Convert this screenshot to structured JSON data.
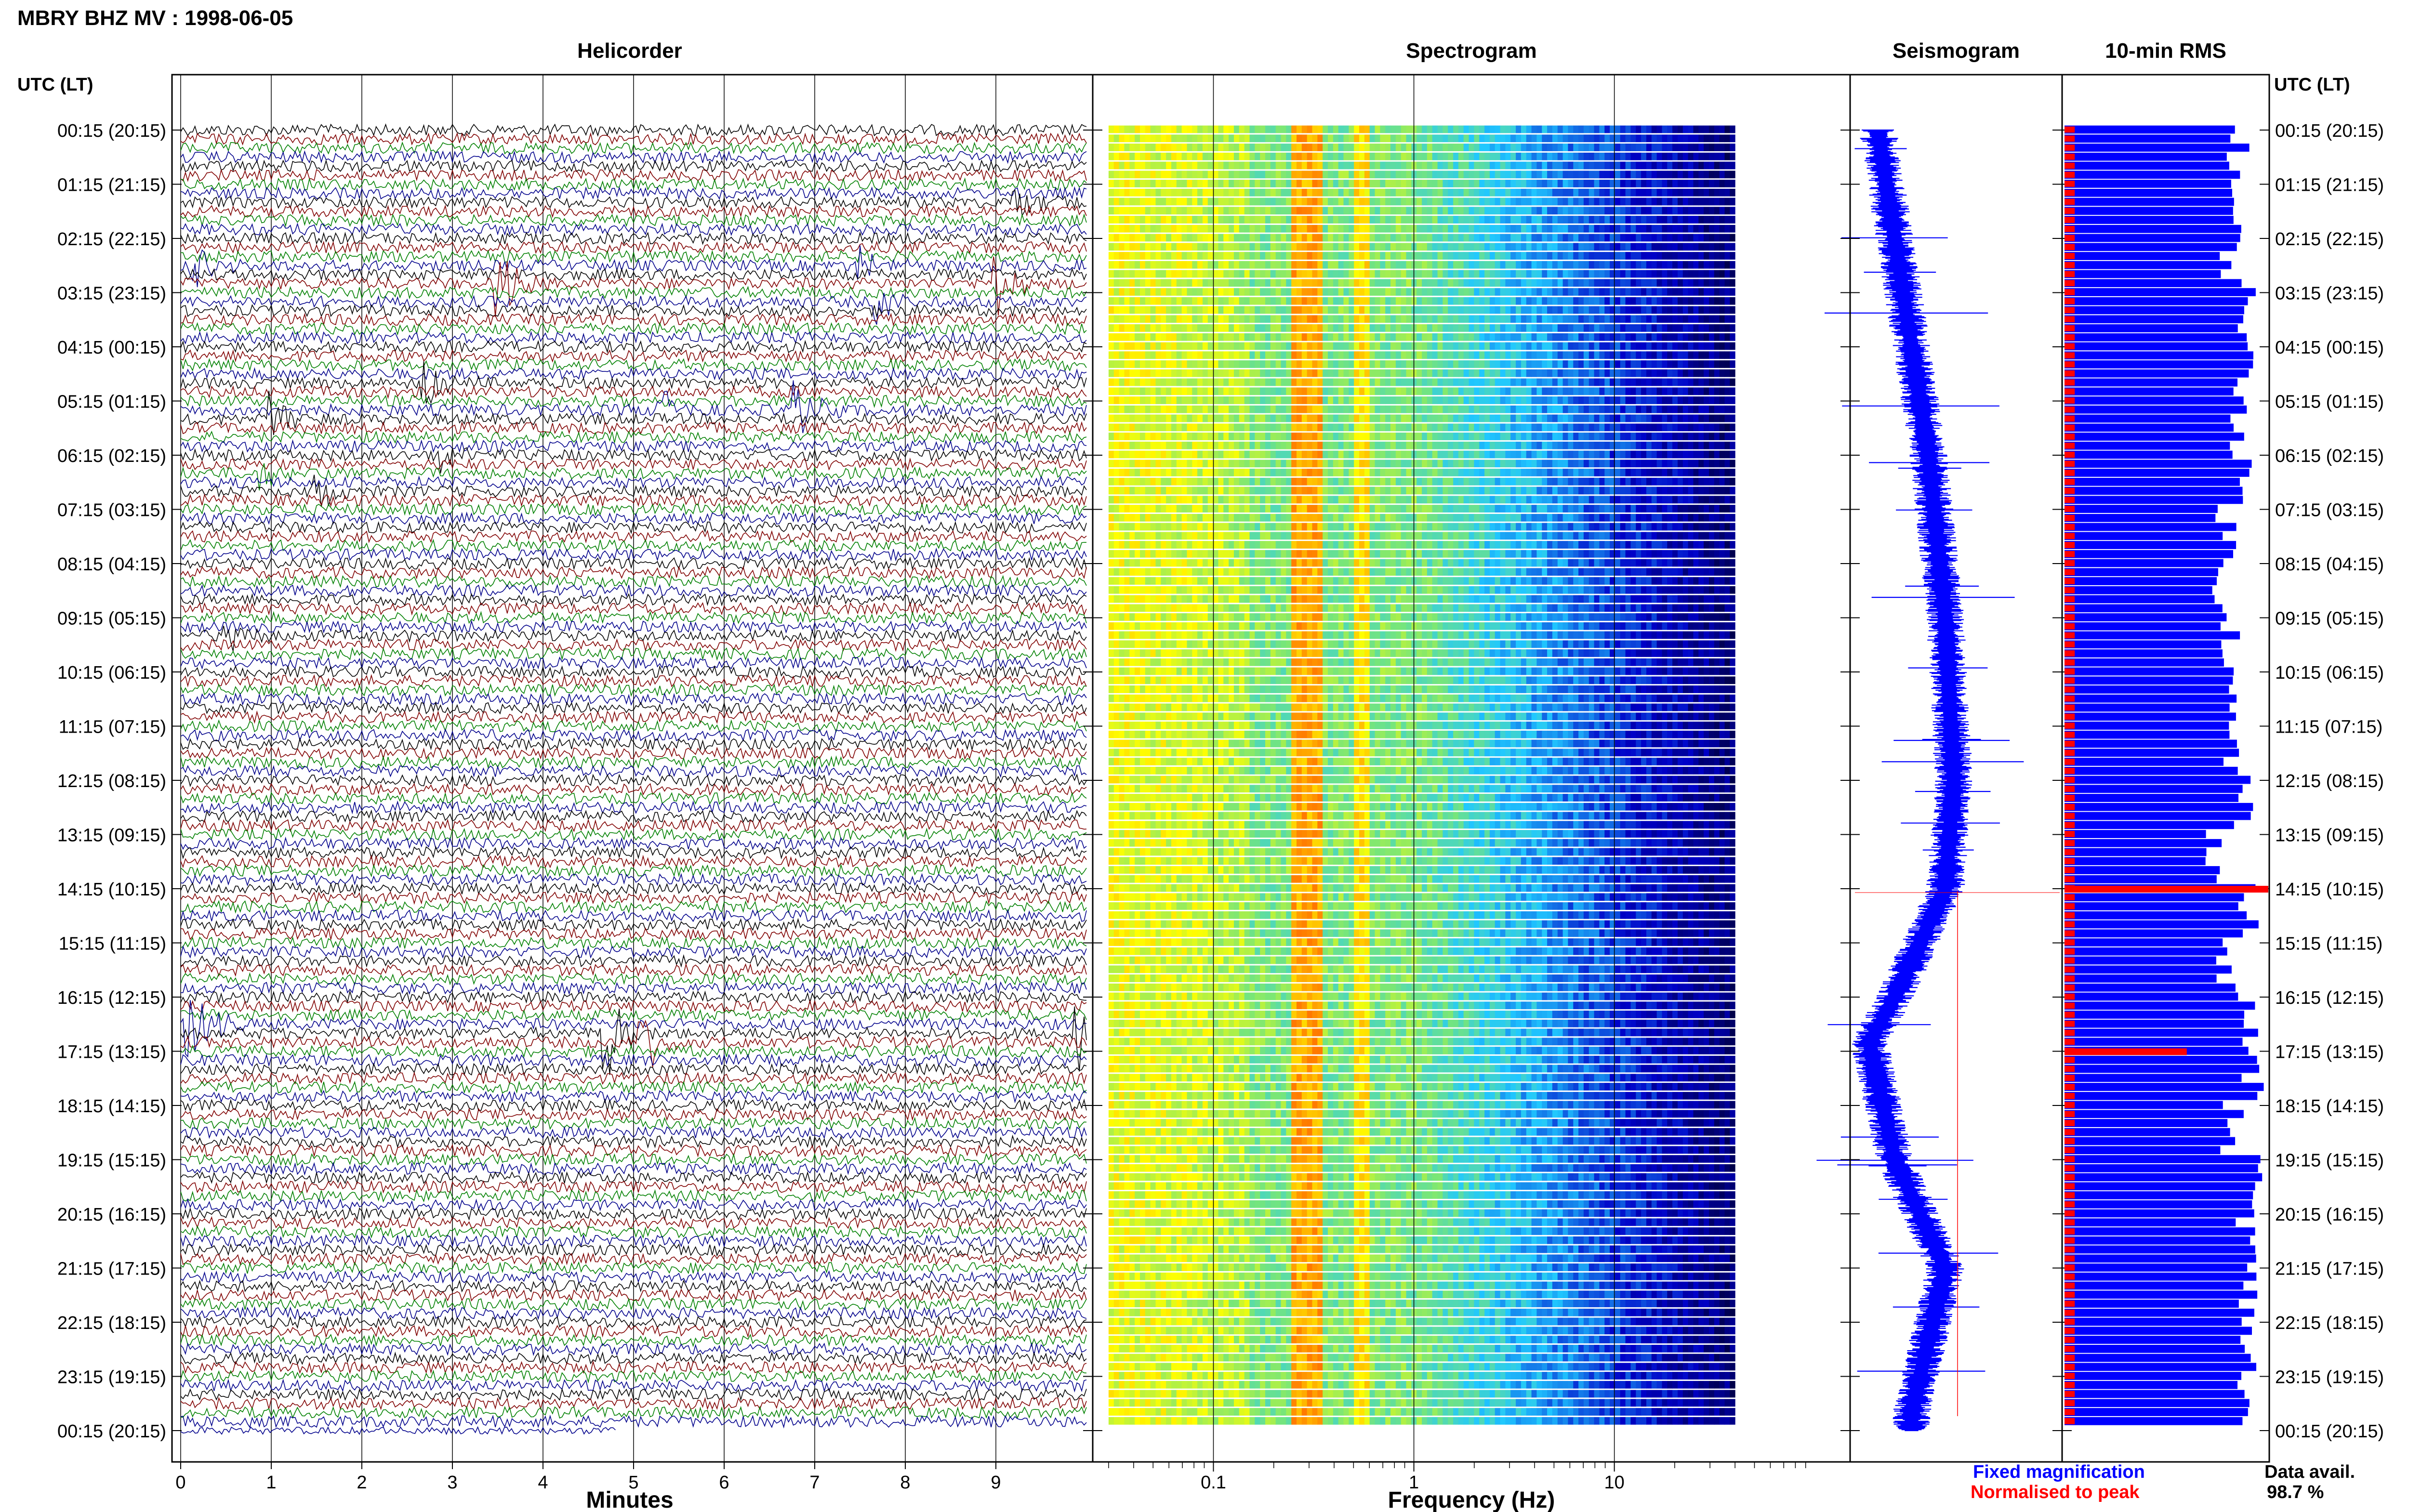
{
  "header": {
    "station_title": "MBRY BHZ MV : 1998-06-05",
    "time_axis_label": "UTC (LT)",
    "time_axis_label_right": "UTC (LT)"
  },
  "panels": {
    "helicorder": {
      "title": "Helicorder",
      "xlabel": "Minutes",
      "x_ticks": [
        "0",
        "1",
        "2",
        "3",
        "4",
        "5",
        "6",
        "7",
        "8",
        "9"
      ]
    },
    "spectrogram": {
      "title": "Spectrogram",
      "xlabel": "Frequency (Hz)",
      "x_ticks": [
        "0.1",
        "1",
        "10"
      ]
    },
    "seismogram": {
      "title": "Seismogram"
    },
    "rms": {
      "title": "10-min RMS"
    }
  },
  "time_labels": [
    "00:15 (20:15)",
    "01:15 (21:15)",
    "02:15 (22:15)",
    "03:15 (23:15)",
    "04:15 (00:15)",
    "05:15 (01:15)",
    "06:15 (02:15)",
    "07:15 (03:15)",
    "08:15 (04:15)",
    "09:15 (05:15)",
    "10:15 (06:15)",
    "11:15 (07:15)",
    "12:15 (08:15)",
    "13:15 (09:15)",
    "14:15 (10:15)",
    "15:15 (11:15)",
    "16:15 (12:15)",
    "17:15 (13:15)",
    "18:15 (14:15)",
    "19:15 (15:15)",
    "20:15 (16:15)",
    "21:15 (17:15)",
    "22:15 (18:15)",
    "23:15 (19:15)",
    "00:15 (20:15)"
  ],
  "legend": {
    "fixed": "Fixed magnification",
    "fixed_color": "#0000ff",
    "normalised": "Normalised to peak",
    "normalised_color": "#ff0000"
  },
  "availability": {
    "label": "Data avail.",
    "value": "98.7 %"
  },
  "colors": {
    "trace_cycle": [
      "#000000",
      "#800000",
      "#008000",
      "#00008b"
    ],
    "seismogram": "#0000ff",
    "rms_fixed": "#0000ff",
    "rms_normalised": "#ff0000"
  },
  "chart_data": [
    {
      "type": "line",
      "title": "Helicorder",
      "xlabel": "Minutes",
      "xlim": [
        0,
        10
      ],
      "rows_per_hour": 6,
      "rows": 144,
      "events": [
        {
          "time_utc": "01:35",
          "minute": 9.2,
          "amp": 1.0
        },
        {
          "time_utc": "02:45",
          "minute": 0.1,
          "amp": 1.3
        },
        {
          "time_utc": "02:45",
          "minute": 7.5,
          "amp": 1.2
        },
        {
          "time_utc": "03:05",
          "minute": 3.5,
          "amp": 1.8
        },
        {
          "time_utc": "03:05",
          "minute": 9.0,
          "amp": 1.7
        },
        {
          "time_utc": "03:25",
          "minute": 7.7,
          "amp": 1.0
        },
        {
          "time_utc": "04:55",
          "minute": 2.7,
          "amp": 1.5
        },
        {
          "time_utc": "05:25",
          "minute": 5.3,
          "amp": 1.3
        },
        {
          "time_utc": "05:25",
          "minute": 6.8,
          "amp": 1.5
        },
        {
          "time_utc": "05:35",
          "minute": 1.0,
          "amp": 1.6
        },
        {
          "time_utc": "06:15",
          "minute": 2.9,
          "amp": 1.0
        },
        {
          "time_utc": "06:35",
          "minute": 0.9,
          "amp": 1.0
        },
        {
          "time_utc": "06:55",
          "minute": 1.5,
          "amp": 1.1
        },
        {
          "time_utc": "09:35",
          "minute": 0.5,
          "amp": 0.9
        },
        {
          "time_utc": "16:45",
          "minute": 0.1,
          "amp": 2.2
        },
        {
          "time_utc": "16:55",
          "minute": 4.7,
          "amp": 2.6
        },
        {
          "time_utc": "16:55",
          "minute": 9.9,
          "amp": 2.0
        },
        {
          "time_utc": "17:05",
          "minute": 5.1,
          "amp": 2.0
        }
      ],
      "data_gap_start": {
        "time_utc": "00:05",
        "minute": 4.8
      }
    },
    {
      "type": "heatmap",
      "title": "Spectrogram",
      "xlabel": "Frequency (Hz)",
      "x_scale": "log",
      "xlim": [
        0.03,
        40
      ],
      "x_ticks": [
        0.1,
        1,
        10
      ],
      "colormap": [
        "#ffff00",
        "#ff8c00",
        "#20c8ff",
        "#0000c8",
        "#00004a"
      ],
      "peak_band_hz": [
        0.25,
        0.35
      ],
      "secondary_band_hz": [
        0.5,
        0.6
      ]
    },
    {
      "type": "area",
      "title": "Seismogram",
      "color": "#0000ff",
      "profile": [
        {
          "time_utc": "00:15",
          "level": 0.9
        },
        {
          "time_utc": "03:15",
          "level": 0.6
        },
        {
          "time_utc": "06:15",
          "level": 0.3
        },
        {
          "time_utc": "09:15",
          "level": 0.1
        },
        {
          "time_utc": "12:15",
          "level": 0.0
        },
        {
          "time_utc": "14:15",
          "level": 0.1
        },
        {
          "time_utc": "16:15",
          "level": 0.7
        },
        {
          "time_utc": "17:05",
          "level": 1.0
        },
        {
          "time_utc": "19:15",
          "level": 0.7
        },
        {
          "time_utc": "21:15",
          "level": 0.1
        },
        {
          "time_utc": "23:55",
          "level": 0.5
        }
      ]
    },
    {
      "type": "bar",
      "title": "10-min RMS",
      "series": [
        {
          "name": "Fixed magnification",
          "values_hourly": [
            0.85,
            0.82,
            0.82,
            0.9,
            0.88,
            0.87,
            0.86,
            0.8,
            0.78,
            0.82,
            0.8,
            0.82,
            0.88,
            0.75,
            0.9,
            0.78,
            0.9,
            0.92,
            0.82,
            0.92,
            0.9,
            0.9,
            0.9,
            0.88
          ]
        },
        {
          "name": "Normalised to peak",
          "values_hourly": [
            0.05,
            0.05,
            0.05,
            0.05,
            0.05,
            0.05,
            0.05,
            0.05,
            0.05,
            0.05,
            0.05,
            0.05,
            0.05,
            0.05,
            0.05,
            0.05,
            0.05,
            0.05,
            0.05,
            0.05,
            0.05,
            0.05,
            0.05,
            0.05
          ],
          "peaks": [
            {
              "time_utc": "14:15",
              "value": 1.0
            },
            {
              "time_utc": "17:15",
              "value": 0.6
            }
          ]
        }
      ]
    }
  ]
}
